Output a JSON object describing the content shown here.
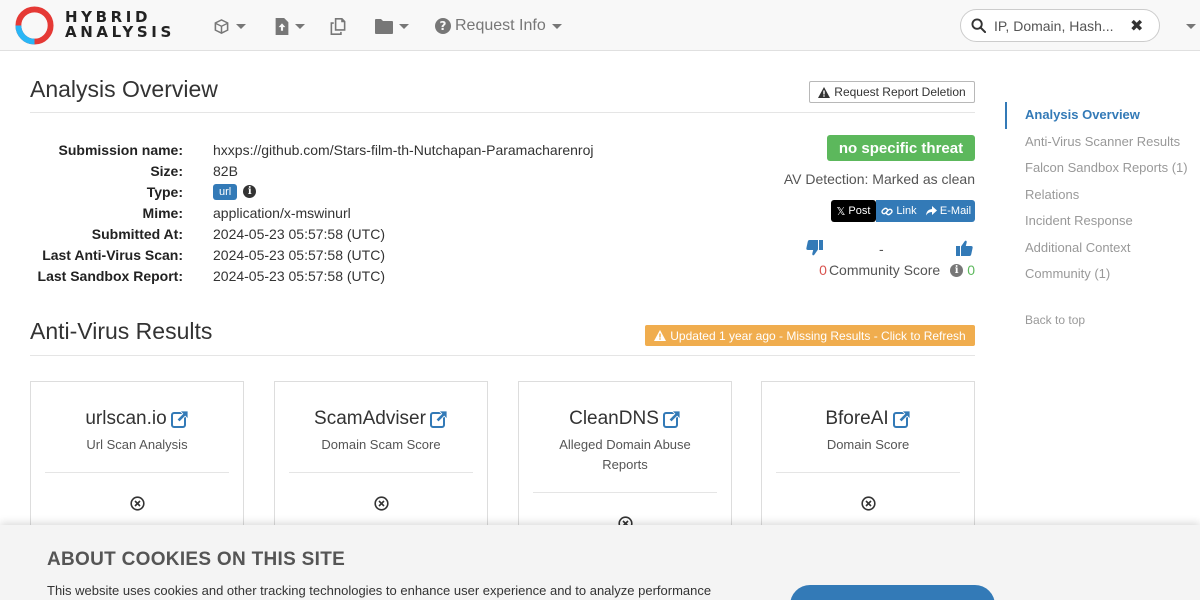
{
  "brand": {
    "logo_line1": "HYBRID",
    "logo_line2": "ANALYSIS",
    "colors": {
      "red": "#e53935",
      "blue": "#29b6f6",
      "link": "#337ab7",
      "green": "#5cb85c",
      "orange": "#f0ad4e"
    }
  },
  "nav": {
    "icons": [
      "cube-icon",
      "file-upload-icon",
      "copy-icon",
      "folder-icon"
    ],
    "request_info_label": "Request Info",
    "search_placeholder": "IP, Domain, Hash..."
  },
  "overview": {
    "title": "Analysis Overview",
    "delete_button": "Request Report Deletion",
    "fields": [
      {
        "label": "Submission name:",
        "value": "hxxps://github.com/Stars-film-th-Nutchapan-Paramacharenroj"
      },
      {
        "label": "Size:",
        "value": "82B"
      },
      {
        "label": "Type:",
        "value": "url"
      },
      {
        "label": "Mime:",
        "value": "application/x-mswinurl"
      },
      {
        "label": "Submitted At:",
        "value": "2024-05-23 05:57:58 (UTC)"
      },
      {
        "label": "Last Anti-Virus Scan:",
        "value": "2024-05-23 05:57:58 (UTC)"
      },
      {
        "label": "Last Sandbox Report:",
        "value": "2024-05-23 05:57:58 (UTC)"
      }
    ],
    "verdict": "no specific threat",
    "av_detection": "AV Detection: Marked as clean",
    "share": {
      "post": "Post",
      "link": "Link",
      "email": "E-Mail"
    },
    "votes": {
      "dash": "-",
      "down": "0",
      "up": "0",
      "label": "Community Score"
    }
  },
  "av_results": {
    "title": "Anti-Virus Results",
    "refresh_badge": "Updated 1 year ago - Missing Results - Click to Refresh",
    "cards": [
      {
        "name": "urlscan.io",
        "subtitle": "Url Scan Analysis"
      },
      {
        "name": "ScamAdviser",
        "subtitle": "Domain Scam Score"
      },
      {
        "name": "CleanDNS",
        "subtitle": "Alleged Domain Abuse Reports"
      },
      {
        "name": "BforeAI",
        "subtitle": "Domain Score"
      }
    ]
  },
  "sidebar": {
    "items": [
      {
        "label": "Analysis Overview",
        "active": true
      },
      {
        "label": "Anti-Virus Scanner Results"
      },
      {
        "label": "Falcon Sandbox Reports (1)"
      },
      {
        "label": "Relations"
      },
      {
        "label": "Incident Response"
      },
      {
        "label": "Additional Context"
      },
      {
        "label": "Community (1)"
      }
    ],
    "back_to_top": "Back to top"
  },
  "cookie": {
    "title": "ABOUT COOKIES ON THIS SITE",
    "text": "This website uses cookies and other tracking technologies to enhance user experience and to analyze performance"
  }
}
